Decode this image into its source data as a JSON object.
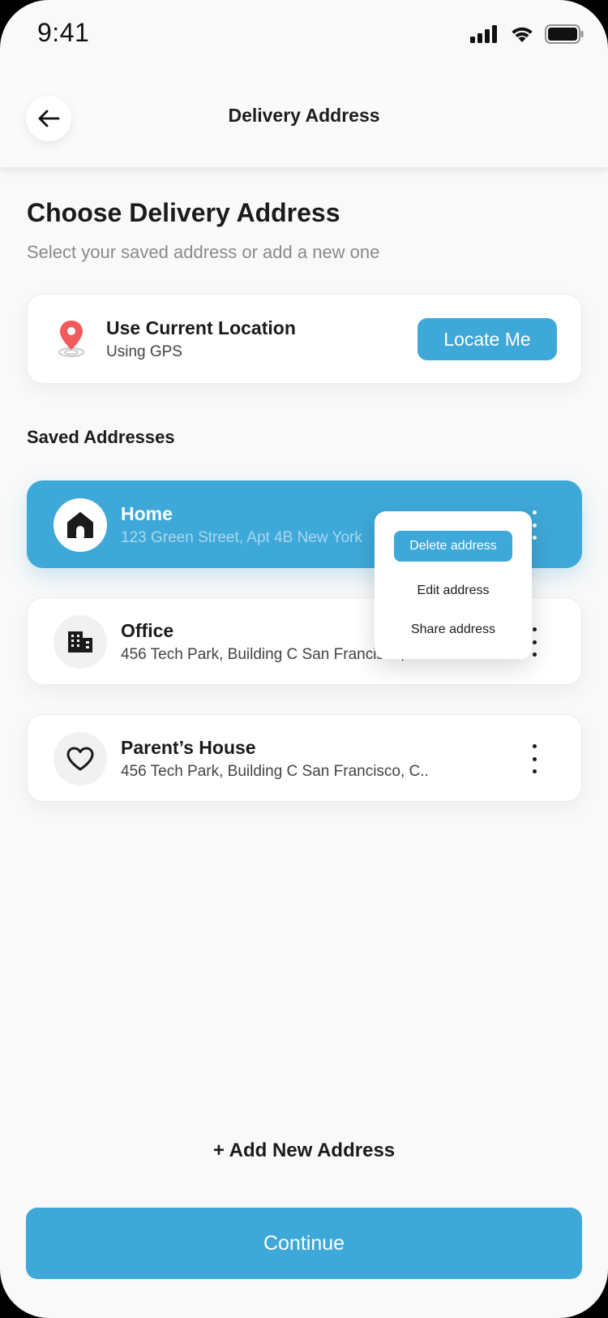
{
  "status_bar": {
    "time": "9:41"
  },
  "header": {
    "title": "Delivery Address"
  },
  "page": {
    "title": "Choose Delivery Address",
    "subtitle": "Select your saved address or add a new one"
  },
  "current_location": {
    "title": "Use Current Location",
    "subtitle": "Using GPS",
    "button_label": "Locate Me",
    "icon": "map-pin-icon"
  },
  "saved_section": {
    "label": "Saved Addresses"
  },
  "addresses": [
    {
      "name": "Home",
      "line": "123 Green Street, Apt 4B New York",
      "icon": "home-icon",
      "selected": true
    },
    {
      "name": "Office",
      "line": "456 Tech Park, Building C San Francisco, CA",
      "icon": "building-icon",
      "selected": false
    },
    {
      "name": "Parent’s House",
      "line": "456 Tech Park, Building C San Francisco, C..",
      "icon": "heart-icon",
      "selected": false
    }
  ],
  "context_menu": {
    "items": [
      "Delete address",
      "Edit address",
      "Share address"
    ]
  },
  "actions": {
    "add_new": "+ Add New Address",
    "continue": "Continue"
  },
  "colors": {
    "accent": "#3ea8d8",
    "pin": "#f25b5b",
    "background": "#f9f9f9"
  }
}
